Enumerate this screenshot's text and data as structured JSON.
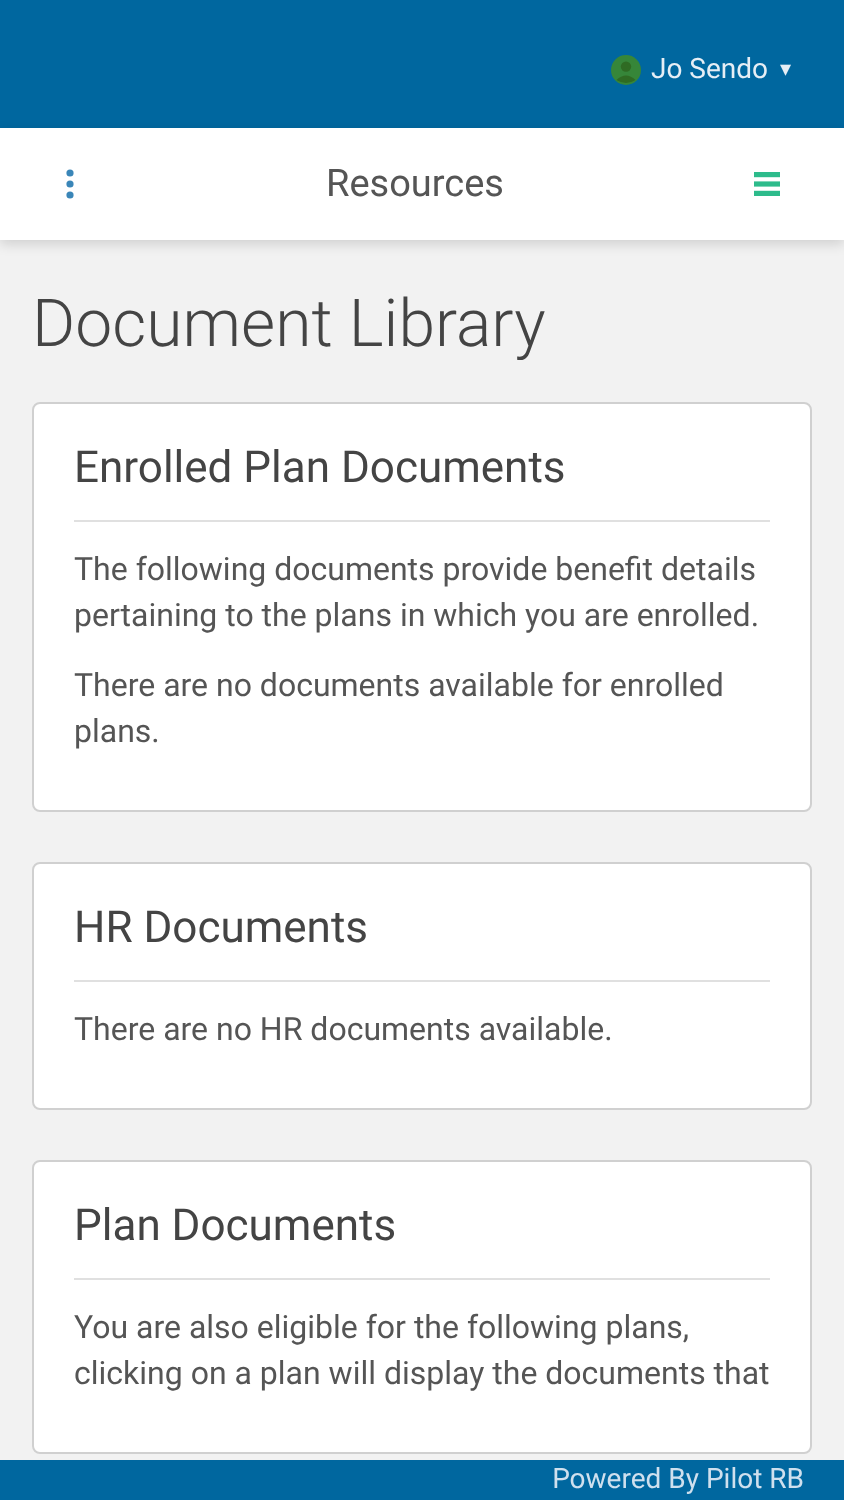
{
  "header": {
    "user_name": "Jo Sendo",
    "dropdown_caret": "▾"
  },
  "nav": {
    "title": "Resources"
  },
  "page_title": "Document Library",
  "sections": [
    {
      "heading": "Enrolled Plan Documents",
      "paragraphs": [
        "The following documents provide benefit details pertaining to the plans in which you are enrolled.",
        "There are no documents available for enrolled plans."
      ]
    },
    {
      "heading": "HR Documents",
      "paragraphs": [
        "There are no HR documents available."
      ]
    },
    {
      "heading": "Plan Documents",
      "paragraphs": [
        "You are also eligible for the following plans, clicking on a plan will display the documents that"
      ]
    }
  ],
  "footer": {
    "text": "Powered By Pilot RB"
  }
}
